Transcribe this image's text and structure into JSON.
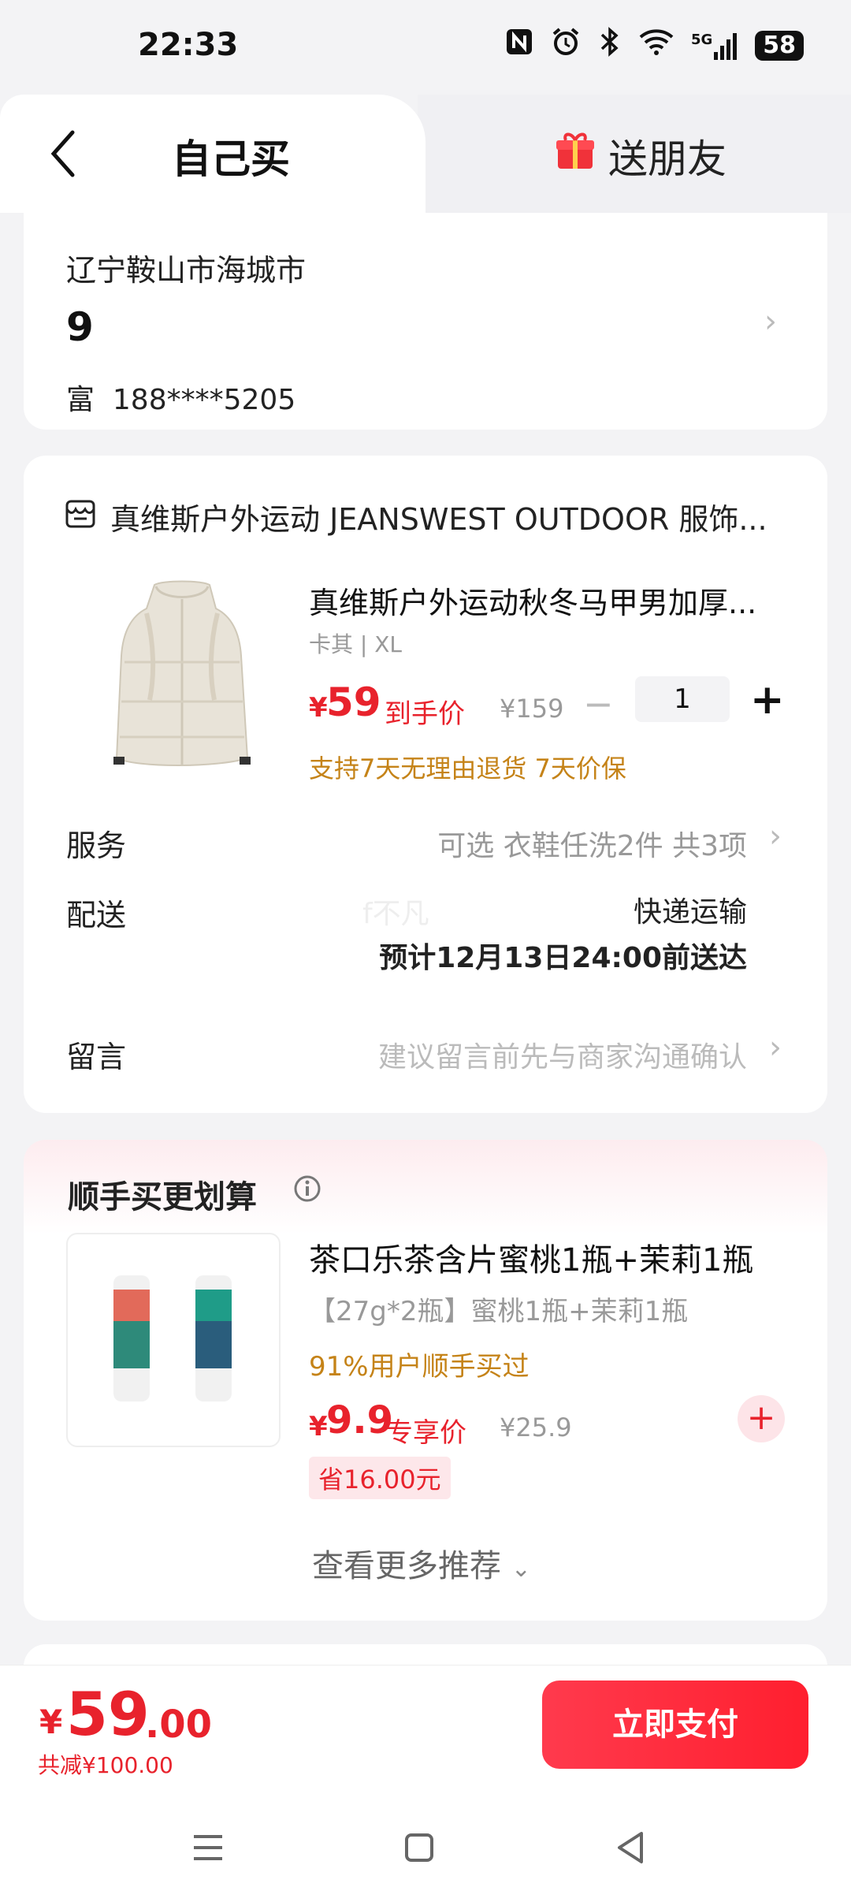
{
  "status": {
    "time": "22:33",
    "battery": "58",
    "network": "5G"
  },
  "tabs": {
    "self": "自己买",
    "friend": "送朋友"
  },
  "address": {
    "region": "辽宁鞍山市海城市",
    "detail": "9",
    "contact_name": "富",
    "contact_phone": "188****5205"
  },
  "order": {
    "shop": "真维斯户外运动 JEANSWEST OUTDOOR 服饰...",
    "product": {
      "title": "真维斯户外运动秋冬马甲男加厚...",
      "spec": "卡其 | XL",
      "price_symbol": "¥",
      "price": "59",
      "price_label": "到手价",
      "original_price": "¥159",
      "quantity": "1",
      "promises": "支持7天无理由退货  7天价保"
    },
    "service": {
      "label": "服务",
      "value": "可选 衣鞋任洗2件 共3项"
    },
    "delivery": {
      "label": "配送",
      "method": "快递运输",
      "eta": "预计12月13日24:00前送达"
    },
    "watermark": "f不凡",
    "message": {
      "label": "留言",
      "placeholder": "建议留言前先与商家沟通确认"
    }
  },
  "recommend": {
    "title": "顺手买更划算",
    "item": {
      "name": "茶口乐茶含片蜜桃1瓶+茉莉1瓶",
      "spec": "【27g*2瓶】蜜桃1瓶+茉莉1瓶",
      "social": "91%用户顺手买过",
      "price_symbol": "¥",
      "price": "9.9",
      "price_label": "专享价",
      "original_price": "¥25.9",
      "save": "省16.00元"
    },
    "see_more": "查看更多推荐"
  },
  "footer": {
    "total_symbol": "¥",
    "total_int": "59",
    "total_dec": ".00",
    "discount": "共减¥100.00",
    "pay_label": "立即支付"
  },
  "colors": {
    "accent": "#e8222c",
    "promo": "#c58318"
  }
}
